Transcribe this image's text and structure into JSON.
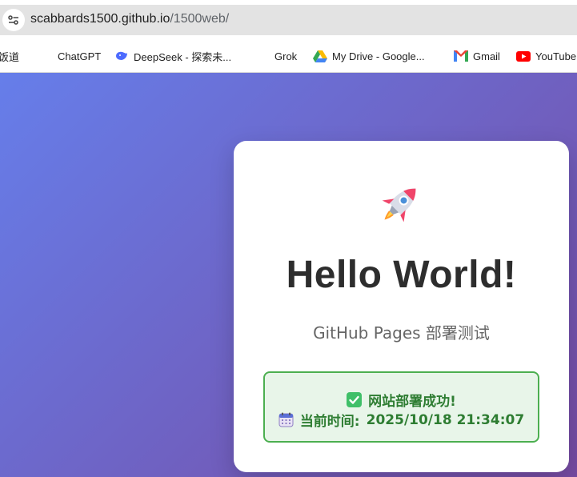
{
  "browser": {
    "url_host": "scabbards1500.github.io",
    "url_path": "/1500web/"
  },
  "bookmarks": [
    {
      "label": "饭道",
      "icon": "none"
    },
    {
      "label": "ChatGPT",
      "icon": "none"
    },
    {
      "label": "DeepSeek - 探索未...",
      "icon": "deepseek-whale-icon"
    },
    {
      "label": "Grok",
      "icon": "none"
    },
    {
      "label": "My Drive - Google...",
      "icon": "google-drive-icon"
    },
    {
      "label": "Gmail",
      "icon": "gmail-icon"
    },
    {
      "label": "YouTube",
      "icon": "youtube-icon"
    }
  ],
  "page": {
    "icon": "rocket-emoji",
    "heading": "Hello World!",
    "subtitle": "GitHub Pages 部署测试",
    "status": {
      "success_text": "网站部署成功!",
      "time_label": "当前时间:",
      "time_value": "2025/10/18 21:34:07"
    }
  },
  "colors": {
    "gradient_start": "#667eea",
    "gradient_end": "#764ba2",
    "status_bg": "#e8f5e9",
    "status_border": "#4caf50",
    "status_text": "#2e7d32"
  }
}
